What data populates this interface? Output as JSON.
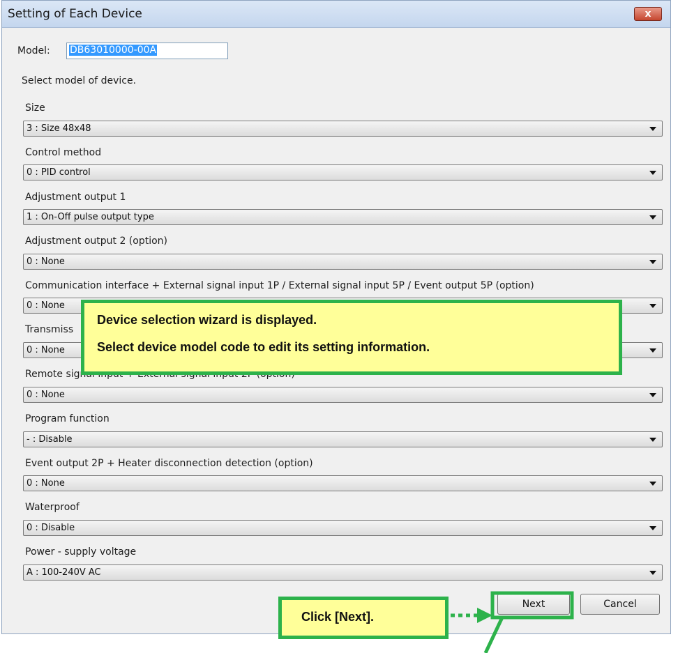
{
  "window": {
    "title": "Setting of Each Device",
    "close_label": "x"
  },
  "model": {
    "label": "Model:",
    "value": "DB63010000-00A"
  },
  "instruction": "Select model of device.",
  "fields": [
    {
      "label": "Size",
      "value": "3 : Size 48x48"
    },
    {
      "label": "Control method",
      "value": "0 : PID control"
    },
    {
      "label": "Adjustment output 1",
      "value": "1 : On-Off pulse output type"
    },
    {
      "label": "Adjustment output 2 (option)",
      "value": "0 : None"
    },
    {
      "label": "Communication interface + External signal input 1P / External signal input 5P / Event output 5P (option)",
      "value": "0 : None"
    },
    {
      "label": "Transmiss",
      "value": "0 : None"
    },
    {
      "label": "Remote signal input + External signal input 2P (option)",
      "value": "0 : None"
    },
    {
      "label": "Program function",
      "value": "- : Disable"
    },
    {
      "label": "Event output 2P + Heater disconnection detection (option)",
      "value": "0 : None"
    },
    {
      "label": "Waterproof",
      "value": "0 : Disable"
    },
    {
      "label": "Power - supply voltage",
      "value": "A : 100-240V AC"
    }
  ],
  "buttons": {
    "next": "Next",
    "cancel": "Cancel"
  },
  "callouts": {
    "wizard": {
      "line1": "Device selection wizard is displayed.",
      "line2": "Select device model code to edit its setting information."
    },
    "next": "Click [Next]."
  },
  "colors": {
    "callout_border": "#2db24b",
    "callout_fill": "#ffff99",
    "selection": "#3399ff"
  }
}
